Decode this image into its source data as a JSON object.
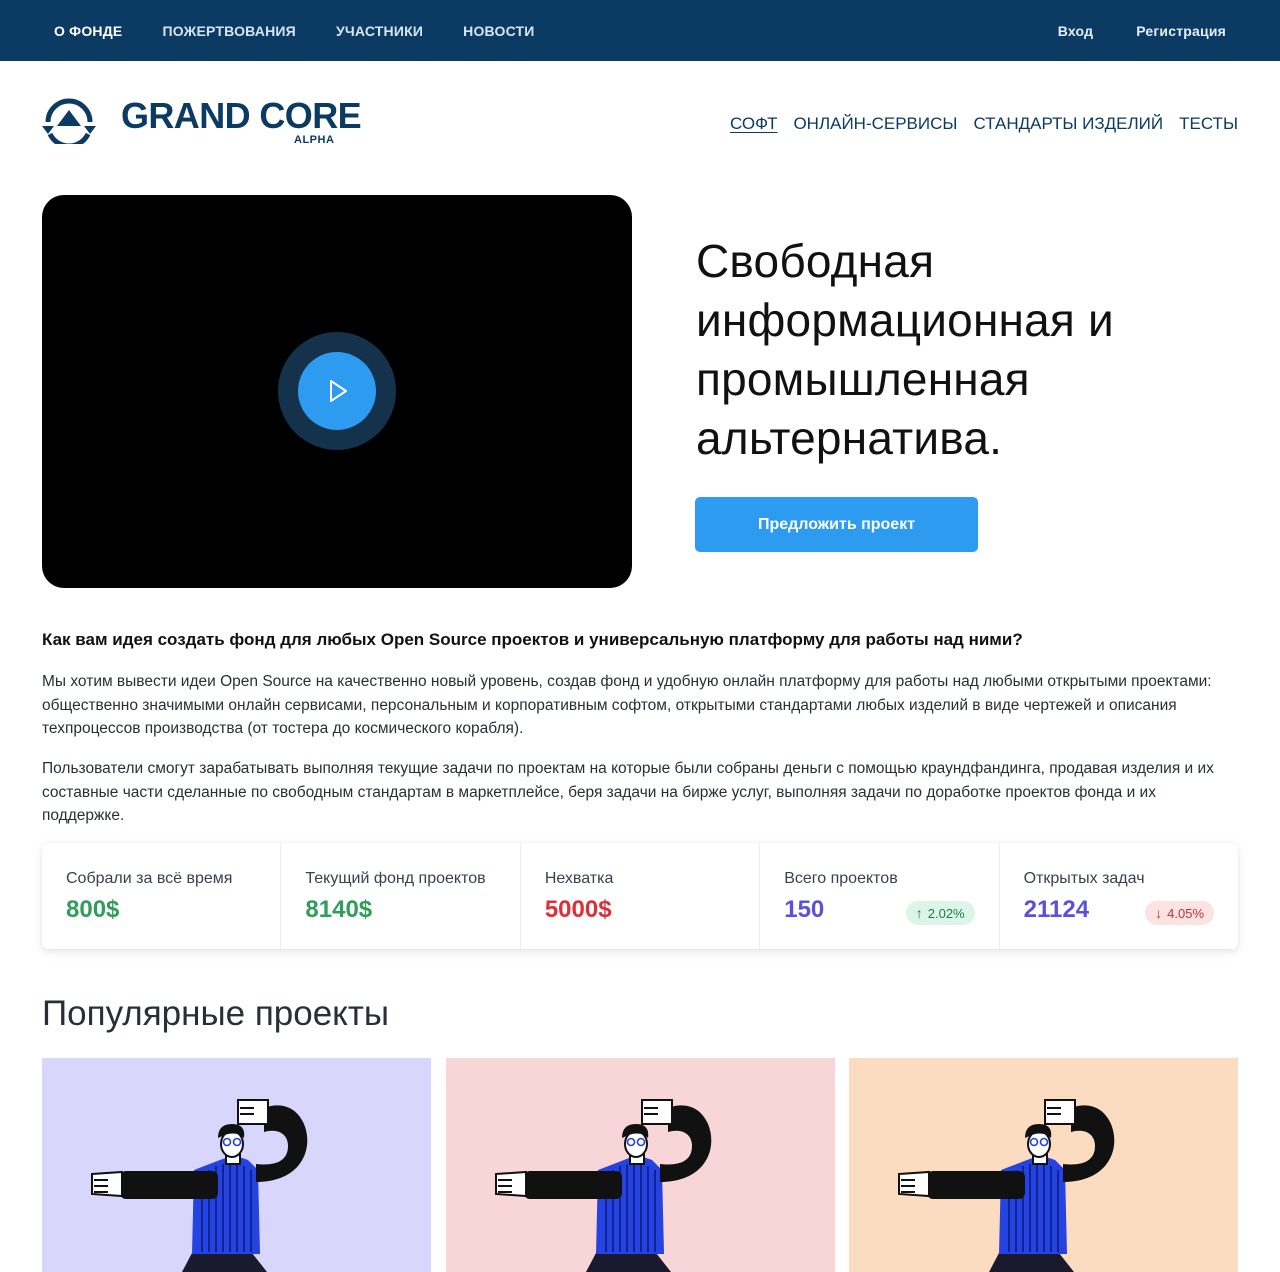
{
  "topbar": {
    "nav": [
      "О ФОНДЕ",
      "ПОЖЕРТВОВАНИЯ",
      "УЧАСТНИКИ",
      "НОВОСТИ"
    ],
    "login": "Вход",
    "register": "Регистрация"
  },
  "header": {
    "logo_text": "GRAND CORE",
    "logo_sub": "ALPHA",
    "nav": [
      "СОФТ",
      "ОНЛАЙН-СЕРВИСЫ",
      "СТАНДАРТЫ ИЗДЕЛИЙ",
      "ТЕСТЫ"
    ]
  },
  "hero": {
    "title": "Свободная информационная и промышленная альтернатива.",
    "cta": "Предложить проект"
  },
  "about": {
    "question": "Как вам идея создать фонд для любых Open Source проектов и универсальную платформу для работы над ними?",
    "p1": "Мы хотим вывести идеи Open Source на качественно новый уровень, создав фонд и удобную онлайн платформу для работы над любыми открытыми проектами: общественно значимыми онлайн сервисами, персональным и корпоративным софтом, открытыми стандартами любых изделий в виде чертежей и описания техпроцессов производства (от тостера до космического корабля).",
    "p2": "Пользователи смогут зарабатывать выполняя текущие задачи по проектам на которые были собраны деньги с помощью краундфандинга, продавая изделия и их составные части сделанные по свободным стандартам в маркетплейсе, беря задачи на бирже услуг, выполняя задачи по доработке проектов фонда и их поддержке."
  },
  "stats": [
    {
      "label": "Собрали за всё время",
      "value": "800$"
    },
    {
      "label": "Текущий фонд проектов",
      "value": "8140$"
    },
    {
      "label": "Нехватка",
      "value": "5000$"
    },
    {
      "label": "Всего проектов",
      "value": "150",
      "badge": "2.02%",
      "trend": "up"
    },
    {
      "label": "Открытых задач",
      "value": "21124",
      "badge": "4.05%",
      "trend": "down"
    }
  ],
  "popular": {
    "title": "Популярные проекты",
    "cards": [
      {
        "bg": "#d8d6fb"
      },
      {
        "bg": "#f8d6d8"
      },
      {
        "bg": "#fbdcc1"
      }
    ]
  },
  "colors": {
    "topbar": "#0b3b63",
    "brand": "#0b3b63",
    "accent": "#2d9cf0",
    "green": "#2e9e5a",
    "red": "#dc2f3a",
    "indigo": "#5b51d8"
  },
  "icons": {
    "play": "play-icon",
    "logo": "logo-mark-icon",
    "trend_up": "arrow-up-icon",
    "trend_down": "arrow-down-icon"
  }
}
